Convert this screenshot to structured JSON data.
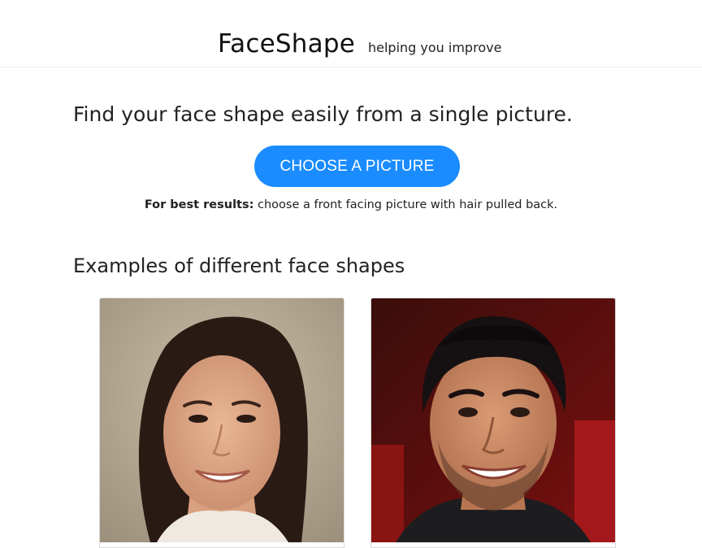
{
  "header": {
    "brand": "FaceShape",
    "tagline": "helping you improve"
  },
  "main": {
    "headline": "Find your face shape easily from a single picture.",
    "cta_label": "CHOOSE A PICTURE",
    "tip_bold": "For best results:",
    "tip_text": " choose a front facing picture with hair pulled back."
  },
  "examples": {
    "title": "Examples of different face shapes",
    "cards": [
      {
        "subject": "woman-smiling-photo"
      },
      {
        "subject": "man-smiling-photo"
      }
    ]
  },
  "colors": {
    "accent": "#1a8cff",
    "text": "#222222",
    "divider": "#ececec"
  }
}
